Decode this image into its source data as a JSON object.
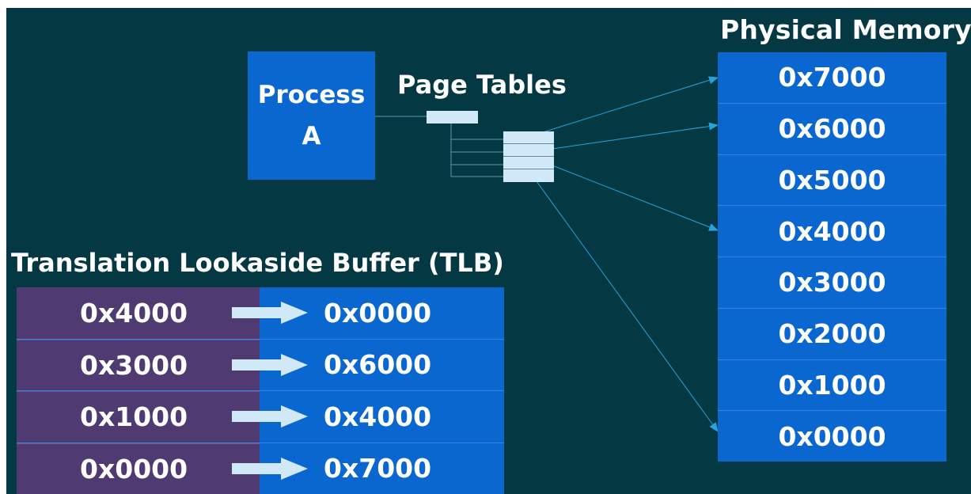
{
  "titles": {
    "physical_memory": "Physical Memory",
    "page_tables": "Page Tables",
    "tlb": "Translation Lookaside Buffer (TLB)"
  },
  "process": {
    "line1": "Process",
    "line2": "A"
  },
  "physical_memory": [
    "0x7000",
    "0x6000",
    "0x5000",
    "0x4000",
    "0x3000",
    "0x2000",
    "0x1000",
    "0x0000"
  ],
  "tlb_entries": [
    {
      "virtual": "0x4000",
      "physical": "0x0000"
    },
    {
      "virtual": "0x3000",
      "physical": "0x6000"
    },
    {
      "virtual": "0x1000",
      "physical": "0x4000"
    },
    {
      "virtual": "0x0000",
      "physical": "0x7000"
    }
  ],
  "colors": {
    "background": "#043843",
    "memory_blue": "#0a67cf",
    "tlb_virtual_purple": "#4f3a72",
    "page_table_light": "#d1e9f6",
    "arrow_line": "#27a3e0"
  }
}
